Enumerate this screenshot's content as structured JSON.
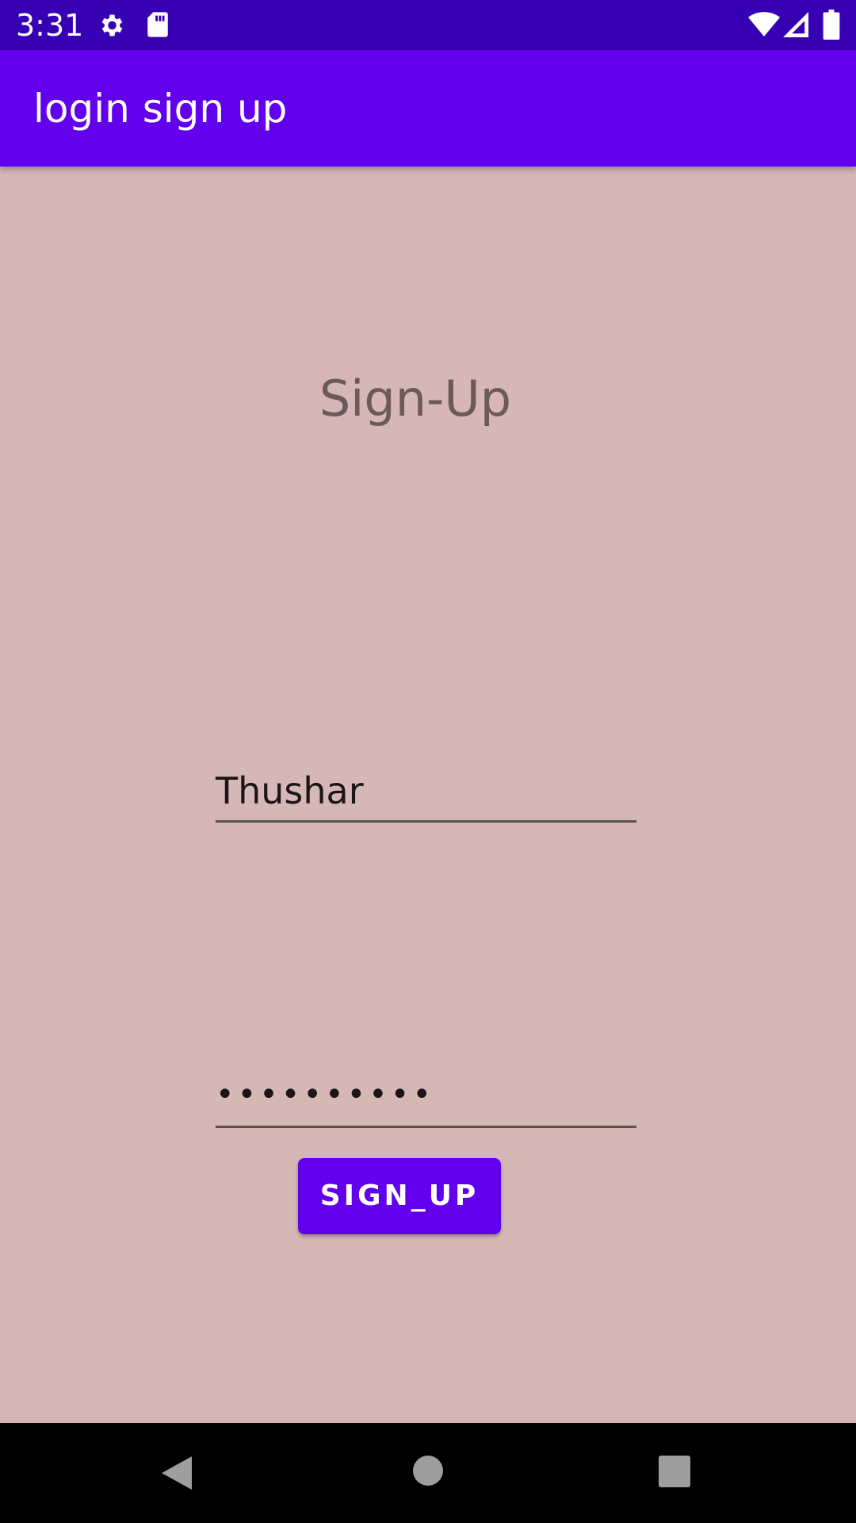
{
  "status_bar": {
    "time": "3:31",
    "icons": [
      "gear-icon",
      "sd-card-icon",
      "wifi-icon",
      "signal-icon",
      "battery-icon"
    ]
  },
  "app_bar": {
    "title": "login sign up"
  },
  "main": {
    "heading": "Sign-Up",
    "username_value": "Thushar",
    "password_value": "••••••••••",
    "signup_button_label": "SIGN_UP"
  },
  "nav_bar": {
    "buttons": [
      "back-icon",
      "home-icon",
      "recents-icon"
    ]
  },
  "colors": {
    "status_bar": "#3700b3",
    "app_bar": "#6200ee",
    "background": "#d5b7b5",
    "button": "#6200ee"
  }
}
